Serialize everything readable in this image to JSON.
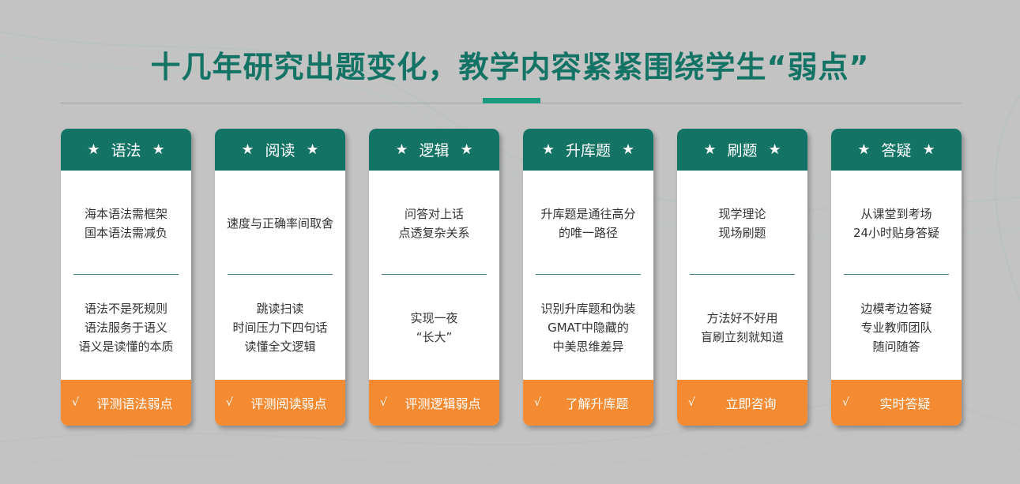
{
  "title": "十几年研究出题变化，教学内容紧紧围绕学生“弱点”",
  "colors": {
    "primary": "#137365",
    "accent": "#f48a31",
    "background": "#c3c3c3"
  },
  "icons": {
    "header": "star-icon",
    "footer": "check-icon"
  },
  "cards": [
    {
      "name": "语法",
      "sec1": [
        "海本语法需框架",
        "国本语法需减负"
      ],
      "sec2": [
        "语法不是死规则",
        "语法服务于语义",
        "语义是读懂的本质"
      ],
      "cta": "评测语法弱点"
    },
    {
      "name": "阅读",
      "sec1": [
        "速度与正确率间取舍"
      ],
      "sec2": [
        "跳读扫读",
        "时间压力下四句话",
        "读懂全文逻辑"
      ],
      "cta": "评测阅读弱点"
    },
    {
      "name": "逻辑",
      "sec1": [
        "问答对上话",
        "点透复杂关系"
      ],
      "sec2": [
        "实现一夜",
        "“长大”"
      ],
      "cta": "评测逻辑弱点"
    },
    {
      "name": "升库题",
      "sec1": [
        "升库题是通往高分",
        "的唯一路径"
      ],
      "sec2": [
        "识别升库题和伪装",
        "GMAT中隐藏的",
        "中美思维差异"
      ],
      "cta": "了解升库题"
    },
    {
      "name": "刷题",
      "sec1": [
        "现学理论",
        "现场刷题"
      ],
      "sec2": [
        "方法好不好用",
        "盲刷立刻就知道"
      ],
      "cta": "立即咨询"
    },
    {
      "name": "答疑",
      "sec1": [
        "从课堂到考场",
        "24小时贴身答疑"
      ],
      "sec2": [
        "边模考边答疑",
        "专业教师团队",
        "随问随答"
      ],
      "cta": "实时答疑"
    }
  ]
}
